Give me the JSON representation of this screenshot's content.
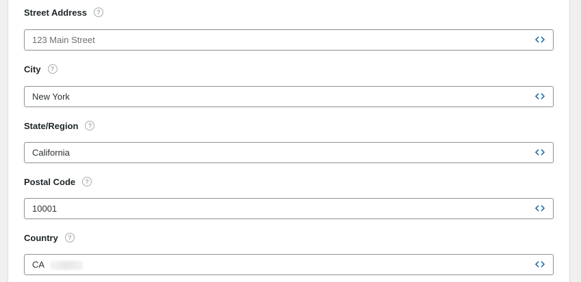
{
  "form": {
    "street": {
      "label": "Street Address",
      "placeholder": "123 Main Street",
      "value": ""
    },
    "city": {
      "label": "City",
      "value": "New York"
    },
    "state": {
      "label": "State/Region",
      "value": "California"
    },
    "postal": {
      "label": "Postal Code",
      "value": "10001"
    },
    "country": {
      "label": "Country",
      "value": "CA"
    }
  },
  "icons": {
    "help": "question-circle-icon",
    "merge_tag": "code-brackets-icon"
  },
  "colors": {
    "accent": "#2271b1",
    "border": "#8c8f94",
    "label": "#1d2327"
  }
}
